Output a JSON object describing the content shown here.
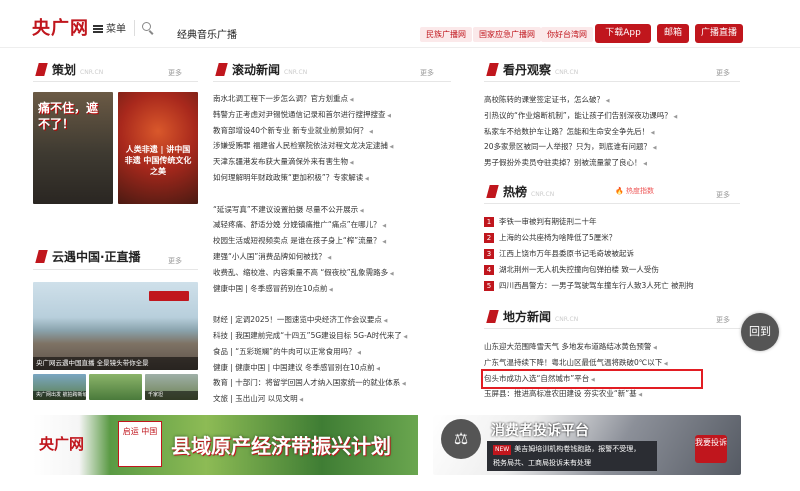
{
  "header": {
    "logo": "央广网",
    "menu_label": "菜单",
    "search_value": "经典音乐广播",
    "chips": [
      "民族广播网",
      "国家应急广播网",
      "你好台湾网"
    ],
    "download_app": "下载App",
    "mail": "邮箱",
    "live": "广播直播",
    "accent": "#c0161d"
  },
  "more_label": "更多",
  "english_tag": "CNR.CN",
  "planning": {
    "title": "策划",
    "img1_text": "痛不住，遮不了！",
    "img2_text": "人类非遗 | 讲中国非遗 中国传统文化之美"
  },
  "cloud": {
    "title": "云遇中国·正直播",
    "caption": "央广网云遇中国直播 全景镜头带你全景",
    "mini1": "央广网出发 航拍跨新城",
    "mini2": "",
    "mini3": "千家坦"
  },
  "rolling": {
    "title": "滚动新闻",
    "items": [
      "南水北调工程下一步怎么调？官方划重点",
      "韩警方正考虑对尹锡悦通信记录和首尔进行搜押搜查",
      "教育部增设40个新专业 新专业就业前景如何？",
      "涉嫌受贿罪 福建省人民检察院依法对程文龙决定逮捕",
      "天津东疆港发布获大量滴保外来有害生物",
      "如何理解明年财政政策“更加积极”？专家解读",
      "",
      "“延误写真”不建议设置拍摄 尽量不公开展示",
      "减轻疼痛、舒适分娩 分娩镇痛推广“痛点”在哪儿？",
      "校园生活或短视频卖点 是谁在孩子身上“榨”流量？",
      "建强“小人国”消费品牌如何被找？",
      "收费乱、缩校准、内容乘量不高 “假夜校”乱象需路多",
      "健康中国 | 冬季感冒药别在10点前",
      "",
      "财经 | 定调2025！一图速览中央经济工作会议要点",
      "科技 | 我国建前完成“十四五”5G建设目标 5G-A时代来了",
      "食品 | “五彩斑斓”的牛肉可以正常食用吗？",
      "健康 | 健康中国 | 中国建议 冬季感冒别在10点前",
      "教育 | 十部门：将留学回国人才纳入国家统一的就业体系",
      "文旅 | 玉出山河 以见文明"
    ]
  },
  "watch": {
    "title": "看丹观察",
    "items": [
      "高校陈转的课堂签定证书，怎么破？",
      "引热议的“作业熔断机制”，能让孩子们告别深夜功课吗？",
      "私家车不给数护车让路？怎能和生命安全争先后！",
      "20多家景区被同一人举报？只为，到底谁有问题？",
      "男子假扮外卖员夺驻卖掉？别被流量蒙了良心！"
    ]
  },
  "hot": {
    "title": "热榜",
    "badge": "热度指数",
    "items": [
      "李铁一审被判有期徒刑二十年",
      "上海的公共座椅为啥降低了5厘米？",
      "江西上饶市万年县委原书记毛奇坡被起诉",
      "湖北荆州一无人机失控撞向包弹拍楼 致一人受伤",
      "四川西昌警方：一男子驾驶驾车撞车行人致3人死亡 被刑拘"
    ]
  },
  "local": {
    "title": "地方新闻",
    "items": [
      "山东迎大范围降雪天气 多地发布道路结冰黄色预警",
      "广东气温持续下降！粤北山区最低气温将跌破0℃以下",
      "包头市成功入选“自然城市”平台",
      "玉屏县：推进高标准农田建设 夯实农业“新”基"
    ]
  },
  "float_btn": "回到",
  "banner1": {
    "logo": "央广网",
    "seal": "启运 中国",
    "title": "县域原产经济带振兴计划"
  },
  "banner2": {
    "title": "消费者投诉平台",
    "label": "NEW",
    "line1": "美吉姆培训机构卷钱跑路，报警不受理，",
    "line2": "税务局共、工商局投诉未有处理",
    "btn": "我要投诉"
  }
}
